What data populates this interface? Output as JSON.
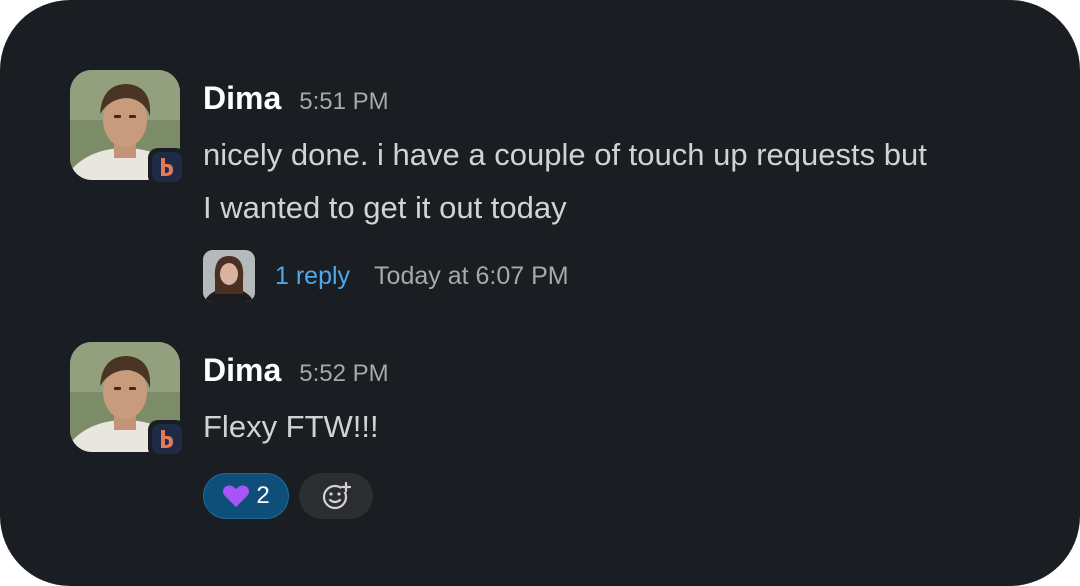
{
  "messages": [
    {
      "author": "Dima",
      "time": "5:51 PM",
      "text": "nicely done. i have a couple of touch up requests but\nI wanted to get it out today",
      "thread": {
        "reply_count": "1 reply",
        "last_reply": "Today at 6:07 PM"
      }
    },
    {
      "author": "Dima",
      "time": "5:52 PM",
      "text": "Flexy FTW!!!",
      "reactions": [
        {
          "emoji": "purple-heart",
          "count": "2"
        }
      ]
    }
  ],
  "colors": {
    "background": "#1a1d21",
    "link": "#4fa8e8",
    "reaction_active": "#0e4f7a",
    "heart": "#9b51e0",
    "org_badge": "#e07a5f"
  }
}
